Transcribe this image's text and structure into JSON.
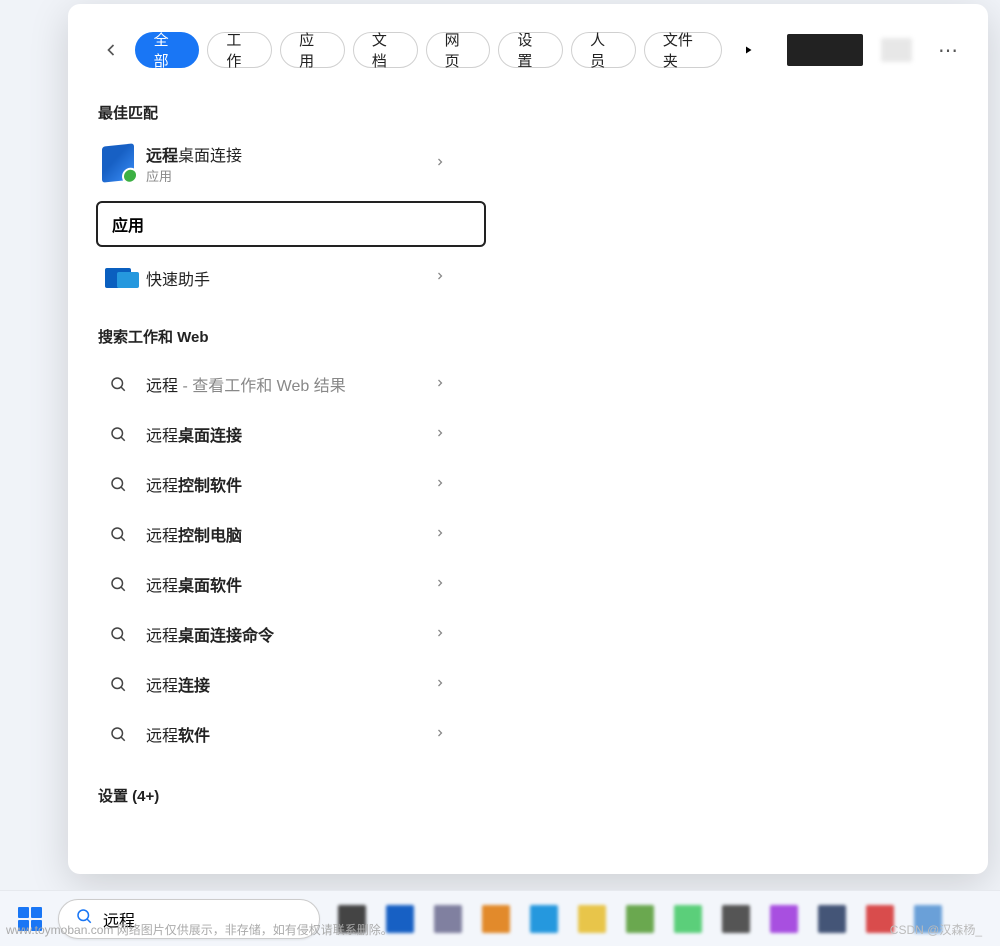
{
  "tabs": [
    "全部",
    "工作",
    "应用",
    "文档",
    "网页",
    "设置",
    "人员",
    "文件夹"
  ],
  "active_tab_index": 0,
  "more_icon": "⋯",
  "sections": {
    "best_match_title": "最佳匹配",
    "apps_title": "应用",
    "web_title": "搜索工作和 Web",
    "settings_title": "设置 (4+)"
  },
  "best_match": {
    "title_prefix_bold": "远程",
    "title_suffix": "桌面连接",
    "subtitle": "应用"
  },
  "app_results": [
    {
      "label": "快速助手"
    }
  ],
  "web_results": [
    {
      "prefix": "远程",
      "bold": "",
      "hint": " - 查看工作和 Web 结果"
    },
    {
      "prefix": "远程",
      "bold": "桌面连接",
      "hint": ""
    },
    {
      "prefix": "远程",
      "bold": "控制软件",
      "hint": ""
    },
    {
      "prefix": "远程",
      "bold": "控制电脑",
      "hint": ""
    },
    {
      "prefix": "远程",
      "bold": "桌面软件",
      "hint": ""
    },
    {
      "prefix": "远程",
      "bold": "桌面连接命令",
      "hint": ""
    },
    {
      "prefix": "远程",
      "bold": "连接",
      "hint": ""
    },
    {
      "prefix": "远程",
      "bold": "软件",
      "hint": ""
    }
  ],
  "search_value": "远程",
  "watermarks": {
    "left": "www.toymoban.com 网络图片仅供展示，非存储，如有侵权请联系删除。",
    "right": "CSDN @汉森杨_"
  },
  "taskbar_colors": [
    "#444444",
    "#1760c4",
    "#8080a0",
    "#e28a2b",
    "#2598de",
    "#e8c54a",
    "#6aa84f",
    "#5bcf7a",
    "#555555",
    "#a84fe0",
    "#445577",
    "#d94c4c",
    "#6aa0d8"
  ]
}
